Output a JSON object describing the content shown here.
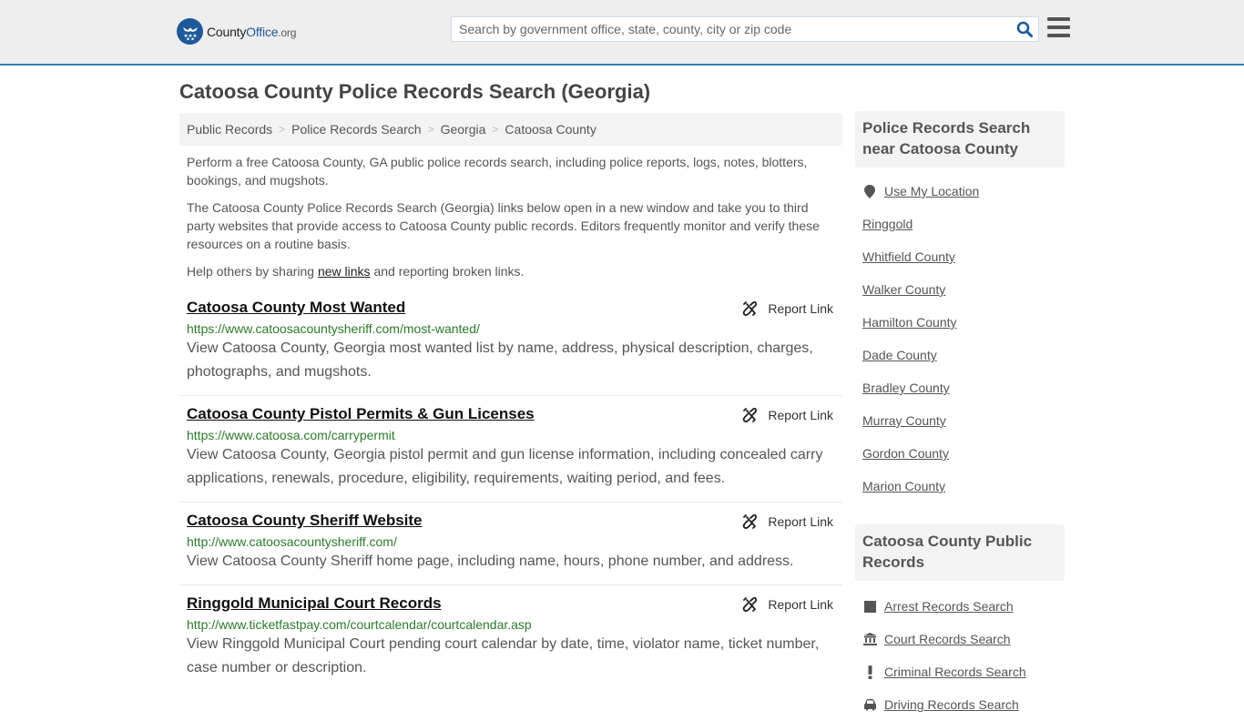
{
  "header": {
    "logo": {
      "name_part1": "County",
      "name_part2": "Office",
      "name_part3": ".org"
    },
    "search": {
      "placeholder": "Search by government office, state, county, city or zip code",
      "value": ""
    },
    "colors": {
      "brand": "#1e5a99",
      "header_border": "#3a7eae",
      "header_bg": "#eeeeee"
    }
  },
  "page": {
    "title": "Catoosa County Police Records Search (Georgia)"
  },
  "breadcrumb": [
    {
      "label": "Public Records"
    },
    {
      "label": "Police Records Search"
    },
    {
      "label": "Georgia"
    },
    {
      "label": "Catoosa County"
    }
  ],
  "intro": {
    "p1": "Perform a free Catoosa County, GA public police records search, including police reports, logs, notes, blotters, bookings, and mugshots.",
    "p2": "The Catoosa County Police Records Search (Georgia) links below open in a new window and take you to third party websites that provide access to Catoosa County public records. Editors frequently monitor and verify these resources on a routine basis.",
    "p3_before": "Help others by sharing ",
    "p3_link": "new links",
    "p3_after": " and reporting broken links."
  },
  "results": [
    {
      "title": "Catoosa County Most Wanted",
      "url": "https://www.catoosacountysheriff.com/most-wanted/",
      "description": "View Catoosa County, Georgia most wanted list by name, address, physical description, charges, photographs, and mugshots.",
      "report_label": "Report Link"
    },
    {
      "title": "Catoosa County Pistol Permits & Gun Licenses",
      "url": "https://www.catoosa.com/carrypermit",
      "description": "View Catoosa County, Georgia pistol permit and gun license information, including concealed carry applications, renewals, procedure, eligibility, requirements, waiting period, and fees.",
      "report_label": "Report Link"
    },
    {
      "title": "Catoosa County Sheriff Website",
      "url": "http://www.catoosacountysheriff.com/",
      "description": "View Catoosa County Sheriff home page, including name, hours, phone number, and address.",
      "report_label": "Report Link"
    },
    {
      "title": "Ringgold Municipal Court Records",
      "url": "http://www.ticketfastpay.com/courtcalendar/courtcalendar.asp",
      "description": "View Ringgold Municipal Court pending court calendar by date, time, violator name, ticket number, case number or description.",
      "report_label": "Report Link"
    }
  ],
  "sidebar": {
    "nearby": {
      "heading": "Police Records Search near Catoosa County",
      "use_location": {
        "label": "Use My Location",
        "icon": "map-marker-icon"
      },
      "items": [
        {
          "label": "Ringgold"
        },
        {
          "label": "Whitfield County"
        },
        {
          "label": "Walker County"
        },
        {
          "label": "Hamilton County"
        },
        {
          "label": "Dade County"
        },
        {
          "label": "Bradley County"
        },
        {
          "label": "Murray County"
        },
        {
          "label": "Gordon County"
        },
        {
          "label": "Marion County"
        }
      ]
    },
    "public_records": {
      "heading": "Catoosa County Public Records",
      "items": [
        {
          "label": "Arrest Records Search",
          "icon": "square-icon"
        },
        {
          "label": "Court Records Search",
          "icon": "courthouse-icon"
        },
        {
          "label": "Criminal Records Search",
          "icon": "exclamation-icon"
        },
        {
          "label": "Driving Records Search",
          "icon": "car-icon"
        }
      ]
    }
  }
}
